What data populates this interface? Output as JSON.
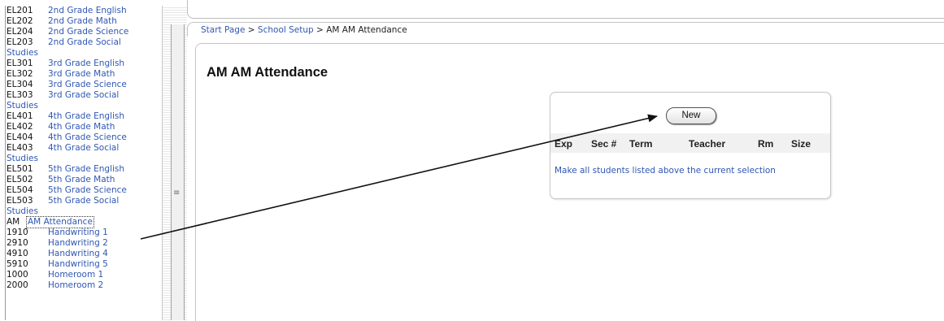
{
  "course_list": [
    {
      "code": "EL201",
      "name": "2nd Grade English",
      "cont": ""
    },
    {
      "code": "EL202",
      "name": "2nd Grade Math",
      "cont": ""
    },
    {
      "code": "EL204",
      "name": "2nd Grade Science",
      "cont": ""
    },
    {
      "code": "EL203",
      "name": "2nd Grade Social",
      "cont": "Studies"
    },
    {
      "code": "EL301",
      "name": "3rd Grade English",
      "cont": ""
    },
    {
      "code": "EL302",
      "name": "3rd Grade Math",
      "cont": ""
    },
    {
      "code": "EL304",
      "name": "3rd Grade Science",
      "cont": ""
    },
    {
      "code": "EL303",
      "name": "3rd Grade Social",
      "cont": "Studies"
    },
    {
      "code": "EL401",
      "name": "4th Grade English",
      "cont": ""
    },
    {
      "code": "EL402",
      "name": "4th Grade Math",
      "cont": ""
    },
    {
      "code": "EL404",
      "name": "4th Grade Science",
      "cont": ""
    },
    {
      "code": "EL403",
      "name": "4th Grade Social",
      "cont": "Studies"
    },
    {
      "code": "EL501",
      "name": "5th Grade English",
      "cont": ""
    },
    {
      "code": "EL502",
      "name": "5th Grade Math",
      "cont": ""
    },
    {
      "code": "EL504",
      "name": "5th Grade Science",
      "cont": ""
    },
    {
      "code": "EL503",
      "name": "5th Grade Social",
      "cont": "Studies"
    },
    {
      "code": "AM",
      "name": "AM Attendance",
      "cont": "",
      "selected": true
    },
    {
      "code": "1910",
      "name": "Handwriting 1",
      "cont": ""
    },
    {
      "code": "2910",
      "name": "Handwriting 2",
      "cont": ""
    },
    {
      "code": "4910",
      "name": "Handwriting 4",
      "cont": ""
    },
    {
      "code": "5910",
      "name": "Handwriting 5",
      "cont": ""
    },
    {
      "code": "1000",
      "name": "Homeroom 1",
      "cont": ""
    },
    {
      "code": "2000",
      "name": "Homeroom 2",
      "cont": ""
    }
  ],
  "breadcrumb": {
    "start_page": "Start Page",
    "separator": ">",
    "school_setup": "School Setup",
    "current": "AM AM Attendance"
  },
  "page_title": "AM AM Attendance",
  "section_panel": {
    "new_label": "New",
    "columns": [
      "Exp",
      "Sec #",
      "Term",
      "Teacher",
      "Rm",
      "Size"
    ],
    "current_selection_link": "Make all students listed above the current selection"
  },
  "colors": {
    "link": "#2f57b3",
    "text": "#111111",
    "panel_border": "#c6c6c6",
    "header_bg": "#f1f1f1"
  }
}
